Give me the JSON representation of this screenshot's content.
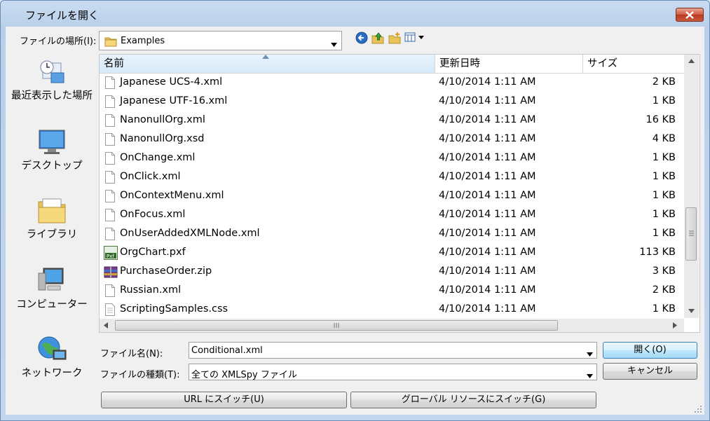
{
  "window": {
    "title": "ファイルを開く"
  },
  "toolbar": {
    "lookin_label": "ファイルの場所(I):",
    "lookin_value": "Examples",
    "icons": [
      "back-icon",
      "up-folder-icon",
      "new-folder-icon",
      "view-menu-icon"
    ]
  },
  "places": [
    {
      "label": "最近表示した場所",
      "icon": "recent-places-icon"
    },
    {
      "label": "デスクトップ",
      "icon": "desktop-icon"
    },
    {
      "label": "ライブラリ",
      "icon": "libraries-icon"
    },
    {
      "label": "コンピューター",
      "icon": "computer-icon"
    },
    {
      "label": "ネットワーク",
      "icon": "network-icon"
    }
  ],
  "list": {
    "columns": [
      "名前",
      "更新日時",
      "サイズ"
    ],
    "rows": [
      {
        "name": "Japanese UCS-4.xml",
        "date": "4/10/2014 1:11 AM",
        "size": "2 KB",
        "icon": "xml"
      },
      {
        "name": "Japanese UTF-16.xml",
        "date": "4/10/2014 1:11 AM",
        "size": "1 KB",
        "icon": "xml"
      },
      {
        "name": "NanonullOrg.xml",
        "date": "4/10/2014 1:11 AM",
        "size": "16 KB",
        "icon": "xml"
      },
      {
        "name": "NanonullOrg.xsd",
        "date": "4/10/2014 1:11 AM",
        "size": "4 KB",
        "icon": "xml"
      },
      {
        "name": "OnChange.xml",
        "date": "4/10/2014 1:11 AM",
        "size": "1 KB",
        "icon": "xml"
      },
      {
        "name": "OnClick.xml",
        "date": "4/10/2014 1:11 AM",
        "size": "1 KB",
        "icon": "xml"
      },
      {
        "name": "OnContextMenu.xml",
        "date": "4/10/2014 1:11 AM",
        "size": "1 KB",
        "icon": "xml"
      },
      {
        "name": "OnFocus.xml",
        "date": "4/10/2014 1:11 AM",
        "size": "1 KB",
        "icon": "xml"
      },
      {
        "name": "OnUserAddedXMLNode.xml",
        "date": "4/10/2014 1:11 AM",
        "size": "1 KB",
        "icon": "xml"
      },
      {
        "name": "OrgChart.pxf",
        "date": "4/10/2014 1:11 AM",
        "size": "113 KB",
        "icon": "pxf"
      },
      {
        "name": "PurchaseOrder.zip",
        "date": "4/10/2014 1:11 AM",
        "size": "3 KB",
        "icon": "zip"
      },
      {
        "name": "Russian.xml",
        "date": "4/10/2014 1:11 AM",
        "size": "2 KB",
        "icon": "xml"
      },
      {
        "name": "ScriptingSamples.css",
        "date": "4/10/2014 1:11 AM",
        "size": "1 KB",
        "icon": "css"
      }
    ]
  },
  "form": {
    "filename_label": "ファイル名(N):",
    "filename_value": "Conditional.xml",
    "filetype_label": "ファイルの種類(T):",
    "filetype_value": "全ての XMLSpy ファイル",
    "open_button": "開く(O)",
    "cancel_button": "キャンセル",
    "url_switch_button": "URL にスイッチ(U)",
    "global_switch_button": "グローバル リソースにスイッチ(G)"
  },
  "colors": {
    "frame": "#b9cfe9",
    "close": "#c85a3f",
    "accent": "#3c7fb1"
  }
}
